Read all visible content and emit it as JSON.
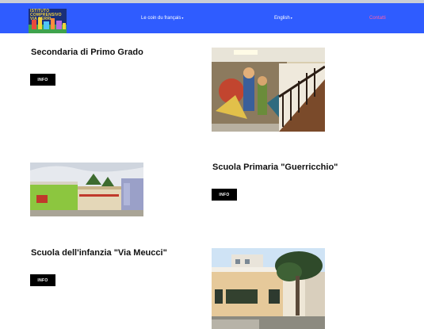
{
  "header": {
    "logo_lines": [
      "ISTITUTO",
      "COMPRENSIVO",
      "VIA PERRI"
    ],
    "nav": {
      "french": "Le coin du français",
      "english": "English",
      "contacts": "Contatti"
    }
  },
  "sections": [
    {
      "title": "Secondaria di Primo Grado",
      "button_label": "INFO"
    },
    {
      "title": "Scuola Primaria \"Guerricchio\"",
      "button_label": "INFO"
    },
    {
      "title": "Scuola dell'infanzia \"Via Meucci\"",
      "button_label": "INFO"
    }
  ],
  "colors": {
    "navbar": "#2f5cff",
    "contacts_link": "#ff5fa8",
    "button": "#000000"
  }
}
